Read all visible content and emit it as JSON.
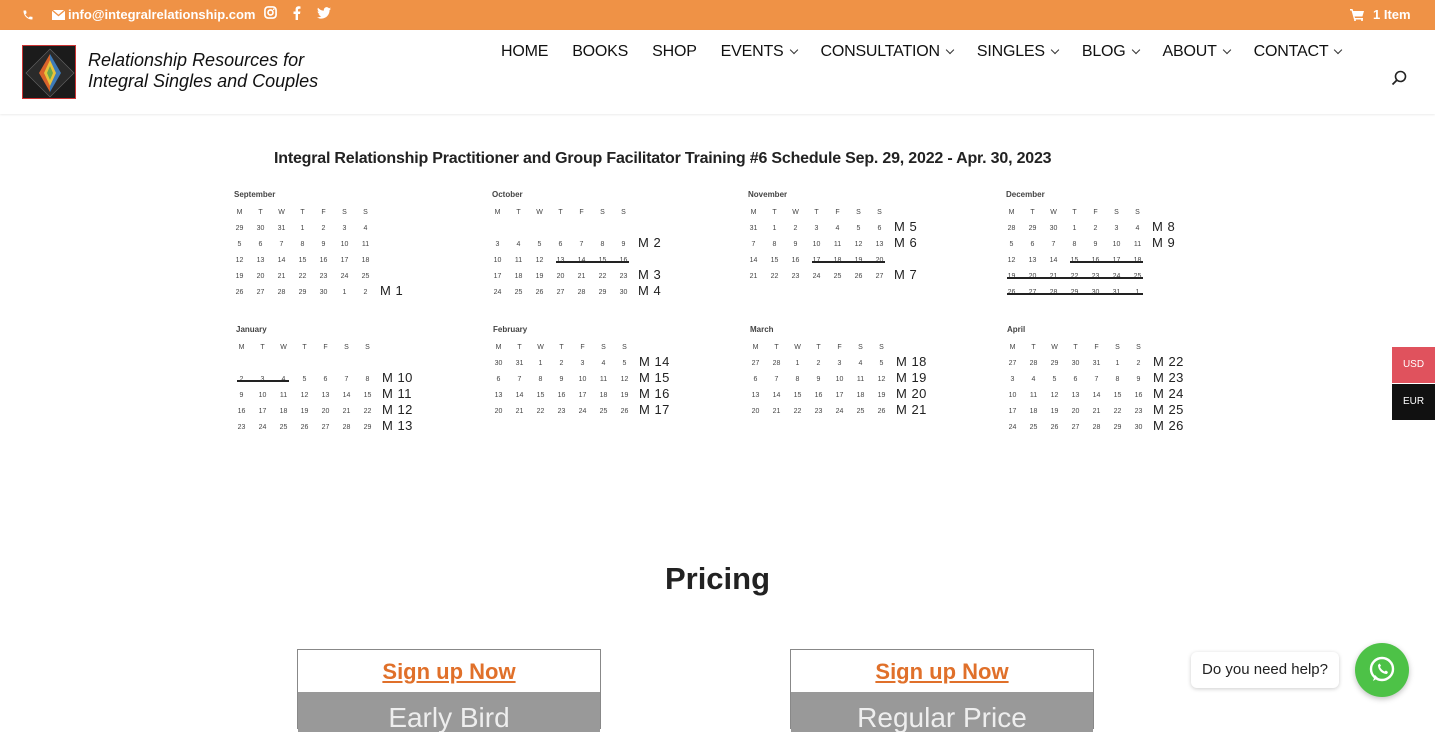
{
  "topbar": {
    "email": "info@integralrelationship.com",
    "cart": "1 Item",
    "icons": [
      "phone-icon",
      "mail-icon",
      "instagram-icon",
      "facebook-icon",
      "twitter-icon",
      "cart-icon"
    ]
  },
  "header": {
    "tagline_line1": "Relationship Resources for",
    "tagline_line2": "Integral Singles and Couples",
    "nav": [
      {
        "label": "HOME",
        "dropdown": false
      },
      {
        "label": "BOOKS",
        "dropdown": false
      },
      {
        "label": "SHOP",
        "dropdown": false
      },
      {
        "label": "EVENTS",
        "dropdown": true
      },
      {
        "label": "CONSULTATION",
        "dropdown": true
      },
      {
        "label": "SINGLES",
        "dropdown": true
      },
      {
        "label": "BLOG",
        "dropdown": true
      },
      {
        "label": "ABOUT",
        "dropdown": true
      },
      {
        "label": "CONTACT",
        "dropdown": true
      }
    ]
  },
  "schedule": {
    "title": "Integral Relationship Practitioner and Group Facilitator Training #6 Schedule Sep. 29, 2022 - Apr. 30, 2023",
    "dow": [
      "M",
      "T",
      "W",
      "T",
      "F",
      "S",
      "S"
    ],
    "months": [
      {
        "name": "September",
        "rows": [
          [
            "29",
            "30",
            "31",
            "1",
            "2",
            "3",
            "4"
          ],
          [
            "5",
            "6",
            "7",
            "8",
            "9",
            "10",
            "11"
          ],
          [
            "12",
            "13",
            "14",
            "15",
            "16",
            "17",
            "18"
          ],
          [
            "19",
            "20",
            "21",
            "22",
            "23",
            "24",
            "25"
          ],
          [
            "26",
            "27",
            "28",
            "29",
            "30",
            "1",
            "2"
          ]
        ],
        "highlights": [
          [
            4,
            3
          ],
          [
            4,
            6
          ]
        ],
        "strikes": [],
        "labels": [
          {
            "row": 4,
            "text": "M 1"
          }
        ]
      },
      {
        "name": "October",
        "rows": [
          [],
          [
            "3",
            "4",
            "5",
            "6",
            "7",
            "8",
            "9"
          ],
          [
            "10",
            "11",
            "12",
            "13",
            "14",
            "15",
            "16"
          ],
          [
            "17",
            "18",
            "19",
            "20",
            "21",
            "22",
            "23"
          ],
          [
            "24",
            "25",
            "26",
            "27",
            "28",
            "29",
            "30"
          ]
        ],
        "highlights": [
          [
            1,
            3
          ],
          [
            1,
            6
          ],
          [
            3,
            3
          ],
          [
            3,
            6
          ],
          [
            4,
            3
          ],
          [
            4,
            6
          ]
        ],
        "strikes": [
          [
            2,
            3,
            6
          ]
        ],
        "labels": [
          {
            "row": 1,
            "text": "M 2"
          },
          {
            "row": 3,
            "text": "M 3"
          },
          {
            "row": 4,
            "text": "M 4"
          }
        ]
      },
      {
        "name": "November",
        "rows": [
          [
            "31",
            "1",
            "2",
            "3",
            "4",
            "5",
            "6"
          ],
          [
            "7",
            "8",
            "9",
            "10",
            "11",
            "12",
            "13"
          ],
          [
            "14",
            "15",
            "16",
            "17",
            "18",
            "19",
            "20"
          ],
          [
            "21",
            "22",
            "23",
            "24",
            "25",
            "26",
            "27"
          ]
        ],
        "highlights": [
          [
            0,
            3
          ],
          [
            0,
            6
          ],
          [
            1,
            3
          ],
          [
            1,
            6
          ],
          [
            3,
            3
          ],
          [
            3,
            6
          ]
        ],
        "strikes": [
          [
            2,
            3,
            6
          ]
        ],
        "labels": [
          {
            "row": 0,
            "text": "M 5"
          },
          {
            "row": 1,
            "text": "M 6"
          },
          {
            "row": 3,
            "text": "M 7"
          }
        ]
      },
      {
        "name": "December",
        "rows": [
          [
            "28",
            "29",
            "30",
            "1",
            "2",
            "3",
            "4"
          ],
          [
            "5",
            "6",
            "7",
            "8",
            "9",
            "10",
            "11"
          ],
          [
            "12",
            "13",
            "14",
            "15",
            "16",
            "17",
            "18"
          ],
          [
            "19",
            "20",
            "21",
            "22",
            "23",
            "24",
            "25"
          ],
          [
            "26",
            "27",
            "28",
            "29",
            "30",
            "31",
            "1"
          ]
        ],
        "highlights": [
          [
            0,
            3
          ],
          [
            0,
            6
          ],
          [
            1,
            3
          ],
          [
            1,
            6
          ]
        ],
        "strikes": [
          [
            2,
            3,
            6
          ],
          [
            3,
            0,
            6
          ],
          [
            4,
            0,
            6
          ]
        ],
        "labels": [
          {
            "row": 0,
            "text": "M 8"
          },
          {
            "row": 1,
            "text": "M 9"
          }
        ]
      },
      {
        "name": "January",
        "rows": [
          [],
          [
            "2",
            "3",
            "4",
            "5",
            "6",
            "7",
            "8"
          ],
          [
            "9",
            "10",
            "11",
            "12",
            "13",
            "14",
            "15"
          ],
          [
            "16",
            "17",
            "18",
            "19",
            "20",
            "21",
            "22"
          ],
          [
            "23",
            "24",
            "25",
            "26",
            "27",
            "28",
            "29"
          ]
        ],
        "highlights": [
          [
            1,
            3
          ],
          [
            1,
            6
          ],
          [
            2,
            3
          ],
          [
            2,
            6
          ],
          [
            3,
            3
          ],
          [
            3,
            6
          ],
          [
            4,
            3
          ],
          [
            4,
            6
          ]
        ],
        "strikes": [
          [
            1,
            0,
            2
          ]
        ],
        "labels": [
          {
            "row": 1,
            "text": "M 10"
          },
          {
            "row": 2,
            "text": "M 11"
          },
          {
            "row": 3,
            "text": "M 12"
          },
          {
            "row": 4,
            "text": "M 13"
          }
        ]
      },
      {
        "name": "February",
        "rows": [
          [
            "30",
            "31",
            "1",
            "2",
            "3",
            "4",
            "5"
          ],
          [
            "6",
            "7",
            "8",
            "9",
            "10",
            "11",
            "12"
          ],
          [
            "13",
            "14",
            "15",
            "16",
            "17",
            "18",
            "19"
          ],
          [
            "20",
            "21",
            "22",
            "23",
            "24",
            "25",
            "26"
          ]
        ],
        "highlights": [
          [
            0,
            3
          ],
          [
            0,
            6
          ],
          [
            1,
            3
          ],
          [
            1,
            6
          ],
          [
            2,
            3
          ],
          [
            2,
            6
          ],
          [
            3,
            3
          ],
          [
            3,
            6
          ]
        ],
        "strikes": [],
        "labels": [
          {
            "row": 0,
            "text": "M 14"
          },
          {
            "row": 1,
            "text": "M 15"
          },
          {
            "row": 2,
            "text": "M 16"
          },
          {
            "row": 3,
            "text": "M 17"
          }
        ]
      },
      {
        "name": "March",
        "rows": [
          [
            "27",
            "28",
            "1",
            "2",
            "3",
            "4",
            "5"
          ],
          [
            "6",
            "7",
            "8",
            "9",
            "10",
            "11",
            "12"
          ],
          [
            "13",
            "14",
            "15",
            "16",
            "17",
            "18",
            "19"
          ],
          [
            "20",
            "21",
            "22",
            "23",
            "24",
            "25",
            "26"
          ]
        ],
        "highlights": [
          [
            0,
            3
          ],
          [
            0,
            6
          ],
          [
            1,
            3
          ],
          [
            1,
            6
          ],
          [
            2,
            3
          ],
          [
            2,
            6
          ],
          [
            3,
            3
          ],
          [
            3,
            6
          ]
        ],
        "strikes": [],
        "labels": [
          {
            "row": 0,
            "text": "M 18"
          },
          {
            "row": 1,
            "text": "M 19"
          },
          {
            "row": 2,
            "text": "M 20"
          },
          {
            "row": 3,
            "text": "M 21"
          }
        ]
      },
      {
        "name": "April",
        "rows": [
          [
            "27",
            "28",
            "29",
            "30",
            "31",
            "1",
            "2"
          ],
          [
            "3",
            "4",
            "5",
            "6",
            "7",
            "8",
            "9"
          ],
          [
            "10",
            "11",
            "12",
            "13",
            "14",
            "15",
            "16"
          ],
          [
            "17",
            "18",
            "19",
            "20",
            "21",
            "22",
            "23"
          ],
          [
            "24",
            "25",
            "26",
            "27",
            "28",
            "29",
            "30"
          ]
        ],
        "highlights": [
          [
            0,
            3
          ],
          [
            0,
            6
          ],
          [
            1,
            3
          ],
          [
            1,
            6
          ],
          [
            2,
            3
          ],
          [
            2,
            6
          ],
          [
            3,
            3
          ],
          [
            3,
            6
          ],
          [
            4,
            3
          ],
          [
            4,
            6
          ]
        ],
        "strikes": [],
        "labels": [
          {
            "row": 0,
            "text": "M 22"
          },
          {
            "row": 1,
            "text": "M 23"
          },
          {
            "row": 2,
            "text": "M 24"
          },
          {
            "row": 3,
            "text": "M 25"
          },
          {
            "row": 4,
            "text": "M 26"
          }
        ]
      }
    ]
  },
  "pricing": {
    "heading": "Pricing",
    "cards": [
      {
        "link": "Sign up Now",
        "band": "Early Bird"
      },
      {
        "link": "Sign up Now",
        "band": "Regular Price"
      }
    ]
  },
  "currency": {
    "usd": "USD",
    "eur": "EUR",
    "usd_color": "#e0525d",
    "eur_color": "#111111"
  },
  "chat": {
    "prompt": "Do you need help?"
  },
  "colors": {
    "topbar": "#ef9246",
    "link": "#e0702a",
    "highlight": "#a9c0e4",
    "whatsapp": "#4dc247"
  }
}
